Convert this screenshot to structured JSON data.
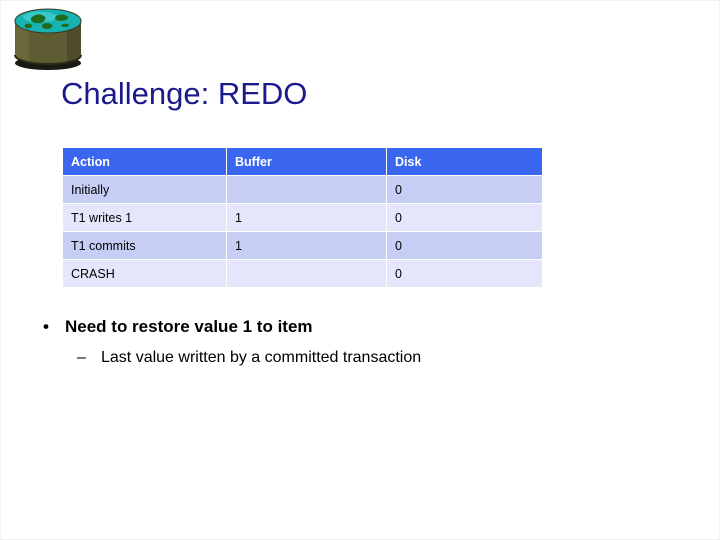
{
  "slide": {
    "title": "Challenge: REDO",
    "title_color": "#1a1a8c",
    "background_color": "#ffffff"
  },
  "logo": {
    "name": "database-cylinder-globe-icon",
    "body_color": "#5e5c33",
    "top_color": "#19b2b2",
    "globe_color": "#1f6b1f"
  },
  "table": {
    "header_bg": "#3a66f0",
    "header_text_color": "#ffffff",
    "row_dark_bg": "#c6cef5",
    "row_light_bg": "#e4e7fb",
    "columns": [
      "Action",
      "Buffer",
      "Disk"
    ],
    "rows": [
      {
        "action": "Initially",
        "buffer": "",
        "disk": "0"
      },
      {
        "action": "T1 writes 1",
        "buffer": "1",
        "disk": "0"
      },
      {
        "action": "T1 commits",
        "buffer": "1",
        "disk": "0"
      },
      {
        "action": "CRASH",
        "buffer": "",
        "disk": "0"
      }
    ]
  },
  "bullets": {
    "level1_marker": "•",
    "level1_text": "Need to restore value 1 to item",
    "level2_marker": "–",
    "level2_text": "Last value written by a committed transaction"
  }
}
